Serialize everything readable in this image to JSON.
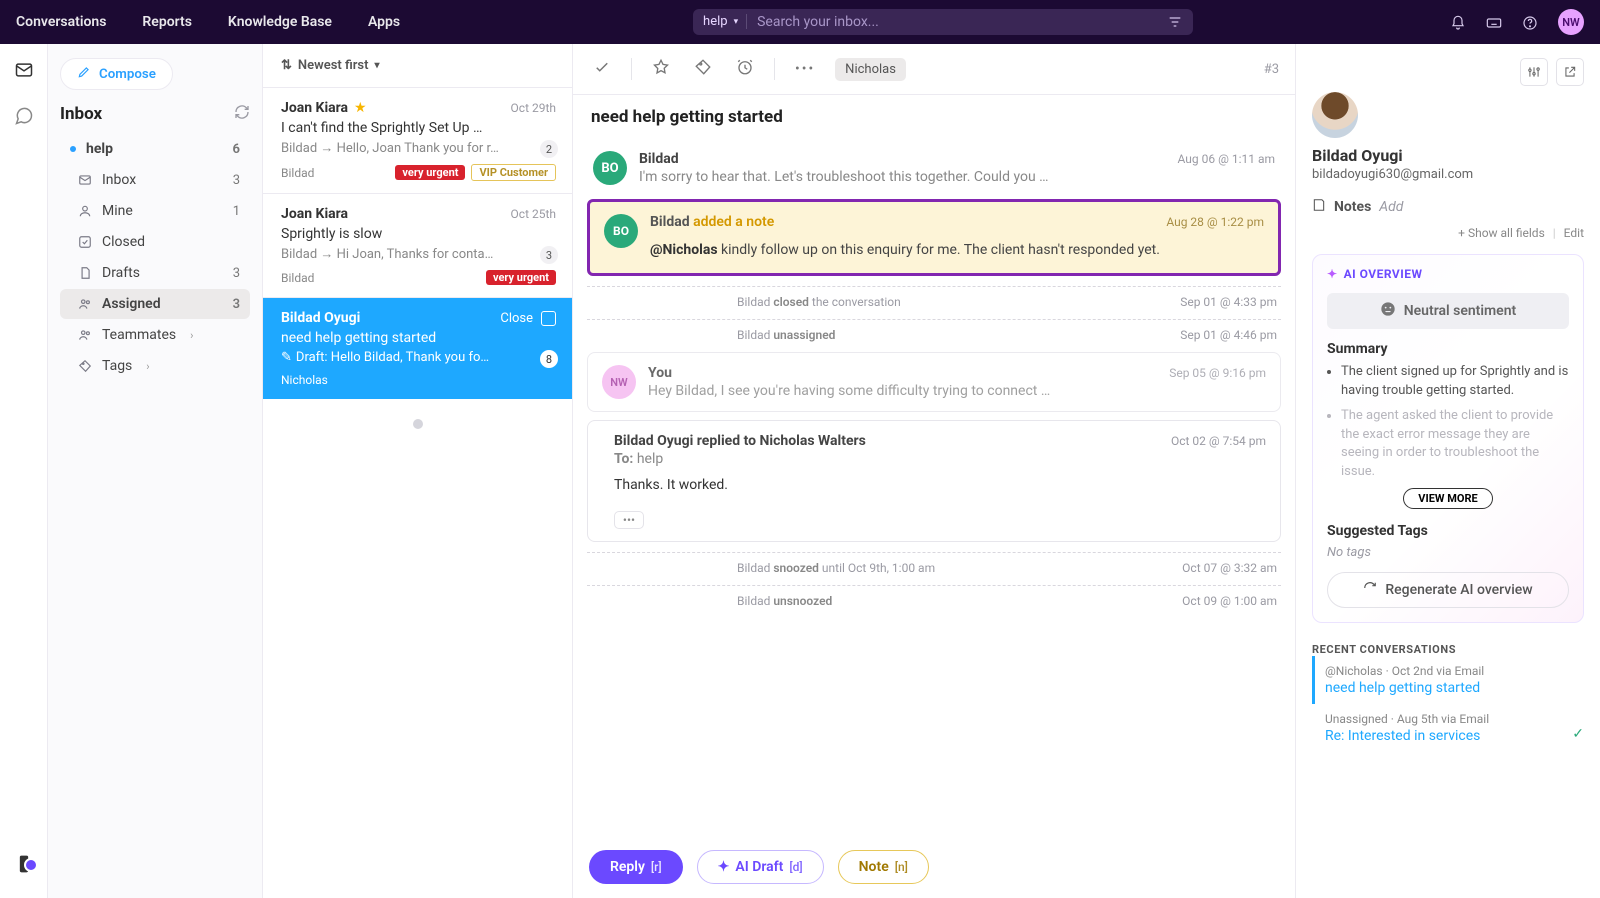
{
  "nav": {
    "conversations": "Conversations",
    "reports": "Reports",
    "kb": "Knowledge Base",
    "apps": "Apps"
  },
  "search": {
    "scope": "help",
    "placeholder": "Search your inbox..."
  },
  "avatar_initials": "NW",
  "compose": "Compose",
  "inbox_header": "Inbox",
  "mailbox": {
    "name": "help",
    "count": "6"
  },
  "folders": {
    "inbox": {
      "label": "Inbox",
      "count": "3"
    },
    "mine": {
      "label": "Mine",
      "count": "1"
    },
    "closed": {
      "label": "Closed"
    },
    "drafts": {
      "label": "Drafts",
      "count": "3"
    },
    "assigned": {
      "label": "Assigned",
      "count": "3"
    },
    "teammates": {
      "label": "Teammates"
    },
    "tags": {
      "label": "Tags"
    }
  },
  "sort": "Newest first",
  "list": [
    {
      "name": "Joan Kiara",
      "starred": true,
      "date": "Oct 29th",
      "subject": "I can't find the Sprightly Set Up …",
      "preview": "Bildad → Hello, Joan Thank you for r…",
      "assignee": "Bildad",
      "badge": "2",
      "pills": [
        "very urgent",
        "VIP Customer"
      ]
    },
    {
      "name": "Joan Kiara",
      "date": "Oct 25th",
      "subject": "Sprightly is slow",
      "preview": "Bildad → Hi Joan,   Thanks for conta…",
      "assignee": "Bildad",
      "badge": "3",
      "pills": [
        "very urgent"
      ]
    },
    {
      "name": "Bildad Oyugi",
      "date_label": "Close",
      "subject": "need help getting started",
      "preview": "Draft: Hello Bildad, Thank you fo…",
      "assignee": "Nicholas",
      "badge": "8",
      "selected": true
    }
  ],
  "thread": {
    "chip": "Nicholas",
    "number": "#3",
    "title": "need help getting started",
    "messages": {
      "m1": {
        "from": "Bildad",
        "ts": "Aug 06 @ 1:11 am",
        "body": "I'm sorry to hear that. Let's troubleshoot this together. Could you …"
      },
      "note": {
        "from": "Bildad",
        "action": "added a note",
        "ts": "Aug 28 @ 1:22 pm",
        "mention": "@Nicholas",
        "body": " kindly follow up on this enquiry for me. The client hasn't responded yet."
      },
      "ev1": {
        "text_a": "Bildad ",
        "text_b": "closed",
        "text_c": " the conversation",
        "ts": "Sep 01 @ 4:33 pm"
      },
      "ev2": {
        "text_a": "Bildad ",
        "text_b": "unassigned",
        "ts": "Sep 01 @ 4:46 pm"
      },
      "m2": {
        "from": "You",
        "ts": "Sep 05 @ 9:16 pm",
        "body": "Hey Bildad,   I see you're having some difficulty trying to connect …"
      },
      "m3": {
        "from": "Bildad Oyugi replied to Nicholas Walters",
        "ts": "Oct 02 @ 7:54 pm",
        "to_label": "To:",
        "to_value": "help",
        "body": "Thanks. It worked."
      },
      "ev3": {
        "text_a": "Bildad ",
        "text_b": "snoozed",
        "text_c": " until Oct 9th, 1:00 am",
        "ts": "Oct 07 @ 3:32 am"
      },
      "ev4": {
        "text_a": "Bildad ",
        "text_b": "unsnoozed",
        "ts": "Oct 09 @ 1:00 am"
      }
    },
    "actions": {
      "reply": "Reply",
      "reply_key": "[r]",
      "ai": "AI Draft",
      "ai_key": "[d]",
      "note": "Note",
      "note_key": "[n]"
    }
  },
  "customer": {
    "name": "Bildad Oyugi",
    "email": "bildadoyugi630@gmail.com",
    "notes_label": "Notes",
    "notes_add": "Add",
    "show_all": "+ Show all fields",
    "edit": "Edit"
  },
  "ai": {
    "title": "AI OVERVIEW",
    "sentiment": "Neutral sentiment",
    "summary_label": "Summary",
    "bullets": [
      "The client signed up for Sprightly and is having trouble getting started.",
      "The agent asked the client to provide the exact error message they are seeing in order to troubleshoot the issue."
    ],
    "view_more": "VIEW MORE",
    "tags_label": "Suggested Tags",
    "no_tags": "No tags",
    "regen": "Regenerate AI overview"
  },
  "recent": {
    "title": "RECENT CONVERSATIONS",
    "items": [
      {
        "meta": "@Nicholas · Oct 2nd via Email",
        "title": "need help getting started",
        "active": true
      },
      {
        "meta": "Unassigned · Aug 5th via Email",
        "title": "Re: Interested in services",
        "check": true
      }
    ]
  }
}
